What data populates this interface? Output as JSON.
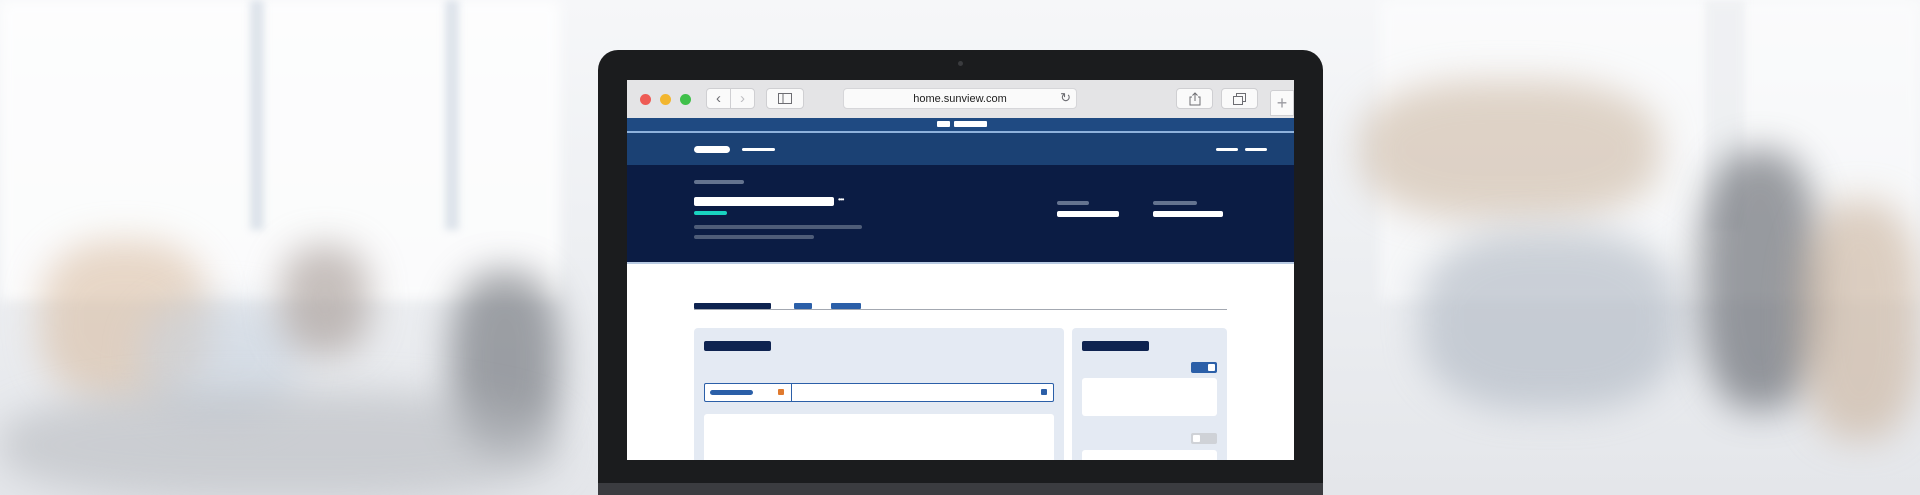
{
  "browser": {
    "url": "home.sunview.com",
    "back_glyph": "‹",
    "forward_glyph": "›",
    "new_tab_glyph": "+",
    "reload_glyph": "↻",
    "icons": [
      "back-icon",
      "forward-icon",
      "sidebar-icon",
      "reload-icon",
      "share-icon",
      "tabs-icon",
      "new-tab-icon"
    ]
  },
  "hero": {
    "more_glyph": "•••"
  },
  "colors": {
    "nav_bg": "#1b4174",
    "hero_bg": "#0b1c44",
    "accent_teal": "#19d3c0",
    "accent_blue": "#2b5fa8",
    "accent_orange": "#e07a2e",
    "card_bg": "#e4eaf3"
  },
  "toggles": {
    "first_on": true,
    "second_on": false
  }
}
